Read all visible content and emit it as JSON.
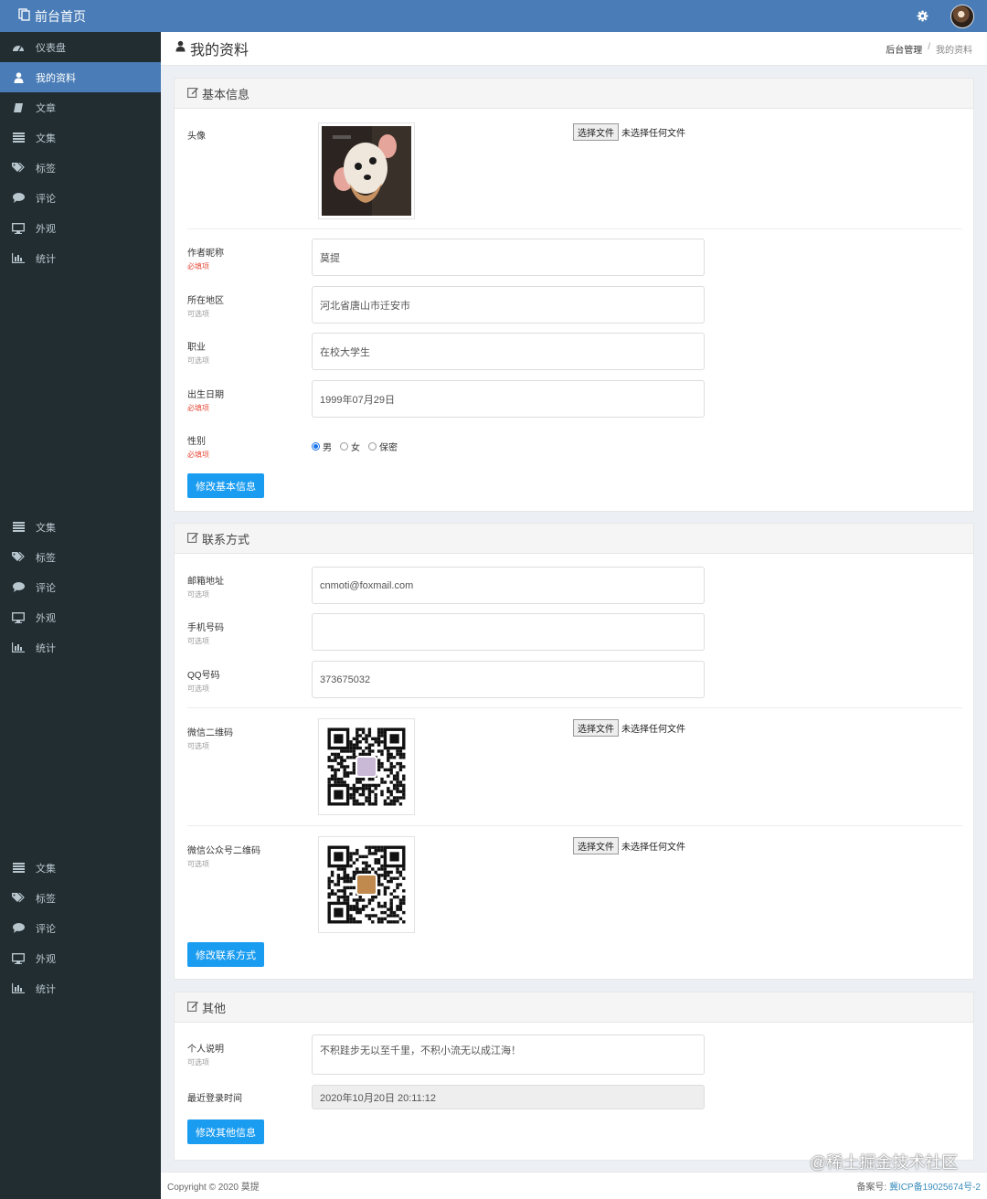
{
  "topbar": {
    "brand": "前台首页",
    "brand_icon": "pages-icon",
    "settings_icon": "gear-icon"
  },
  "sidebar": {
    "items": [
      {
        "label": "仪表盘",
        "icon": "dashboard-icon"
      },
      {
        "label": "我的资料",
        "icon": "user-icon",
        "active": true
      },
      {
        "label": "文章",
        "icon": "book-icon"
      },
      {
        "label": "文集",
        "icon": "list-icon"
      },
      {
        "label": "标签",
        "icon": "tags-icon"
      },
      {
        "label": "评论",
        "icon": "comment-icon"
      },
      {
        "label": "外观",
        "icon": "desktop-icon"
      },
      {
        "label": "统计",
        "icon": "bar-chart-icon"
      }
    ],
    "repeat_group": [
      {
        "label": "文集",
        "icon": "list-icon"
      },
      {
        "label": "标签",
        "icon": "tags-icon"
      },
      {
        "label": "评论",
        "icon": "comment-icon"
      },
      {
        "label": "外观",
        "icon": "desktop-icon"
      },
      {
        "label": "统计",
        "icon": "bar-chart-icon"
      }
    ]
  },
  "header": {
    "title": "我的资料",
    "breadcrumb": [
      "后台管理",
      "我的资料"
    ]
  },
  "basic": {
    "title": "基本信息",
    "avatar_label": "头像",
    "file_button": "选择文件",
    "file_status": "未选择任何文件",
    "nickname": {
      "label": "作者昵称",
      "hint": "必填项",
      "value": "莫提"
    },
    "region": {
      "label": "所在地区",
      "hint": "可选项",
      "value": "河北省唐山市迁安市"
    },
    "job": {
      "label": "职业",
      "hint": "可选项",
      "value": "在校大学生"
    },
    "birthday": {
      "label": "出生日期",
      "hint": "必填项",
      "value": "1999年07月29日"
    },
    "gender": {
      "label": "性别",
      "hint": "必填项",
      "options": [
        "男",
        "女",
        "保密"
      ],
      "selected": "男"
    },
    "submit": "修改基本信息"
  },
  "contact": {
    "title": "联系方式",
    "email": {
      "label": "邮箱地址",
      "hint": "可选项",
      "value": "cnmoti@foxmail.com"
    },
    "phone": {
      "label": "手机号码",
      "hint": "可选项",
      "value": ""
    },
    "qq": {
      "label": "QQ号码",
      "hint": "可选项",
      "value": "373675032"
    },
    "wechat_qr": {
      "label": "微信二维码",
      "hint": "可选项"
    },
    "mp_qr": {
      "label": "微信公众号二维码",
      "hint": "可选项"
    },
    "file_button": "选择文件",
    "file_status": "未选择任何文件",
    "submit": "修改联系方式"
  },
  "other": {
    "title": "其他",
    "bio": {
      "label": "个人说明",
      "hint": "可选项",
      "value": "不积跬步无以至千里，不积小流无以成江海！"
    },
    "last_login": {
      "label": "最近登录时间",
      "value": "2020年10月20日 20:11:12"
    },
    "submit": "修改其他信息"
  },
  "footer": {
    "copyright": "Copyright © 2020 莫提",
    "record_label": "备案号:",
    "record_link": "冀ICP备19025674号-2"
  },
  "watermark": "@稀土掘金技术社区"
}
